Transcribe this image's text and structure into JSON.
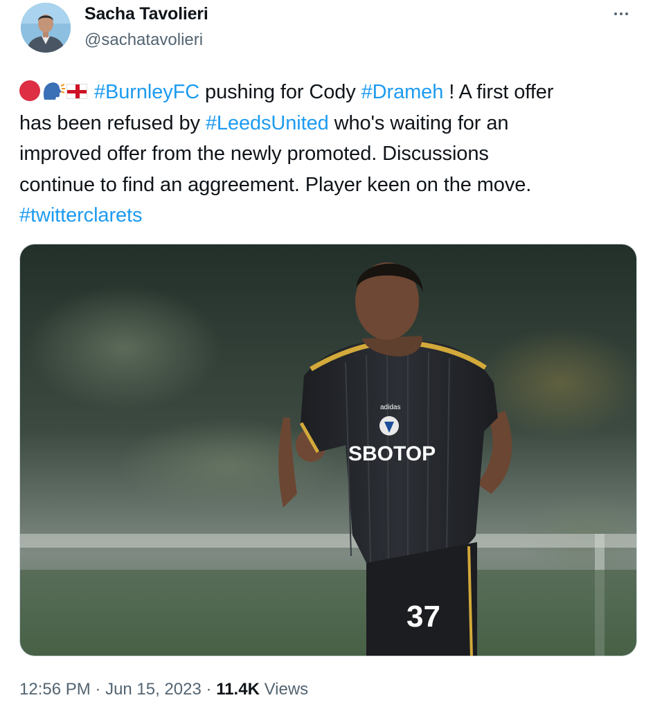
{
  "author": {
    "name": "Sacha Tavolieri",
    "handle": "@sachatavolieri"
  },
  "tweet": {
    "emojis": [
      "red-circle-icon",
      "speaking-head-icon",
      "england-flag-icon"
    ],
    "hashtags": {
      "burnley": "#BurnleyFC",
      "drameh": "#Drameh",
      "leeds": "#LeedsUnited",
      "clarets": "#twitterclarets"
    },
    "text_parts": {
      "p1": " pushing for Cody ",
      "p2": " ! A first offer",
      "p3": "has been refused by ",
      "p4": " who's waiting for an",
      "p5": "improved offer from the newly promoted.  Discussions",
      "p6": "continue to find an aggreement. Player keen on the move."
    }
  },
  "media": {
    "shirt_sponsor": "SBOTOP",
    "shirt_number": "37",
    "shirt_brand": "adidas"
  },
  "footer": {
    "time": "12:56 PM",
    "separator": " · ",
    "date": "Jun 15, 2023",
    "views_count": "11.4K",
    "views_label": " Views"
  },
  "colors": {
    "hashtag": "#1d9bf0",
    "text": "#0f1419",
    "secondary": "#536471"
  }
}
